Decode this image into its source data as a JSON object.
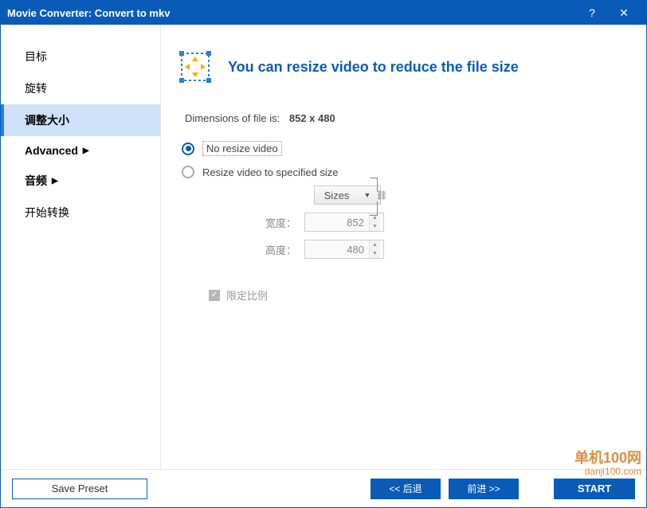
{
  "titlebar": {
    "title": "Movie Converter:  Convert to mkv",
    "help": "?",
    "close": "✕"
  },
  "sidebar": {
    "items": [
      {
        "label": "目标"
      },
      {
        "label": "旋转"
      },
      {
        "label": "调整大小"
      },
      {
        "label": "Advanced"
      },
      {
        "label": "音频"
      },
      {
        "label": "开始转换"
      }
    ]
  },
  "main": {
    "heading": "You can resize video to reduce the file size",
    "dimensions_label": "Dimensions of file is:",
    "dimensions_value": "852 x 480",
    "radio_no_resize": "No resize video",
    "radio_resize": "Resize video to specified size",
    "sizes_button": "Sizes",
    "width_label": "宽度：",
    "height_label": "高度：",
    "width_value": "852",
    "height_value": "480",
    "lock_ratio": "限定比例"
  },
  "footer": {
    "save_preset": "Save Preset",
    "back": "<<  后退",
    "forward": "前进  >>",
    "start": "START"
  },
  "watermark": {
    "line1": "单机100网",
    "line2": "danji100.com"
  }
}
